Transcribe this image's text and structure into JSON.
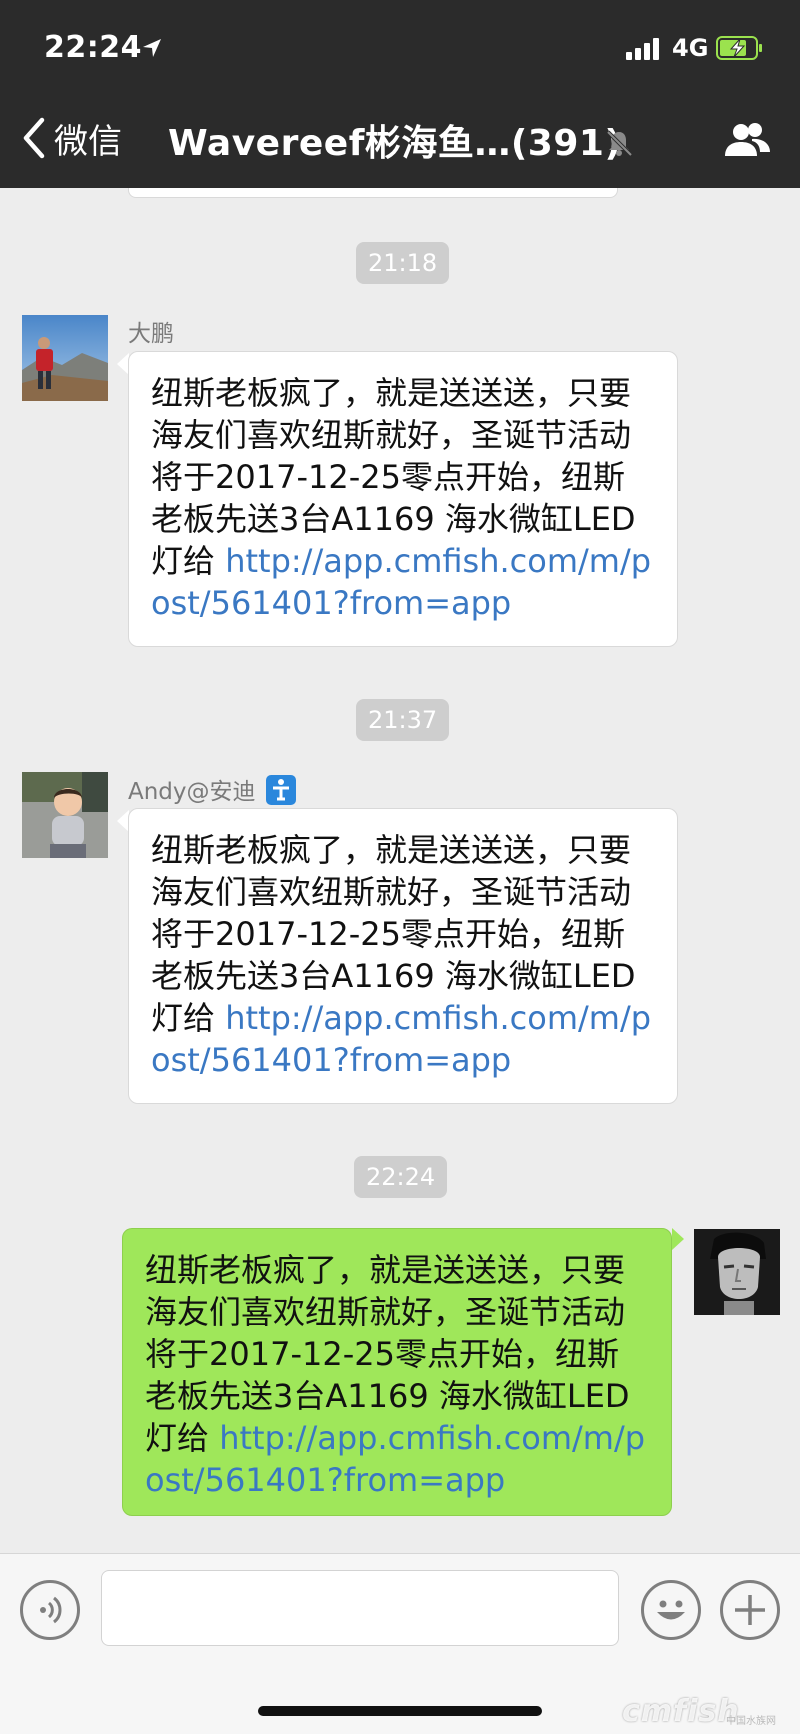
{
  "status_bar": {
    "time": "22:24",
    "network": "4G",
    "location_icon": "location-arrow-icon",
    "signal_icon": "signal-bars-icon",
    "battery_icon": "battery-charging-icon"
  },
  "nav": {
    "back_label": "微信",
    "back_icon": "chevron-left-icon",
    "title": "Wavereef彬海鱼…(391)",
    "mute_icon": "muted-bell-icon",
    "members_icon": "group-members-icon"
  },
  "messages": [
    {
      "timestamp": "21:18",
      "sender": "大鹏",
      "text": "纽斯老板疯了，就是送送送，只要海友们喜欢纽斯就好，圣诞节活动将于2017-12-25零点开始，纽斯老板先送3台A1169 海水微缸LED灯给 ",
      "link": "http://app.cmfish.com/m/post/561401?from=app"
    },
    {
      "timestamp": "21:37",
      "sender": "Andy@安迪",
      "sender_badge_icon": "info-badge-icon",
      "text": "纽斯老板疯了，就是送送送，只要海友们喜欢纽斯就好，圣诞节活动将于2017-12-25零点开始，纽斯老板先送3台A1169 海水微缸LED灯给 ",
      "link": "http://app.cmfish.com/m/post/561401?from=app"
    },
    {
      "timestamp": "22:24",
      "sender": "",
      "outgoing": true,
      "text": "纽斯老板疯了，就是送送送，只要海友们喜欢纽斯就好，圣诞节活动将于2017-12-25零点开始，纽斯老板先送3台A1169 海水微缸LED灯给 ",
      "link": "http://app.cmfish.com/m/post/561401?from=app"
    }
  ],
  "input_bar": {
    "voice_icon": "voice-input-icon",
    "emoji_icon": "emoji-icon",
    "plus_icon": "plus-icon",
    "placeholder": ""
  },
  "watermark": {
    "text": "cmfish",
    "sub": "中国水族网"
  },
  "colors": {
    "topbar": "#2b2b2b",
    "chat_bg": "#ededed",
    "outgoing_bubble": "#9fe75a",
    "incoming_bubble": "#ffffff",
    "link": "#3a78c3",
    "timestamp_bg": "#cecece"
  }
}
